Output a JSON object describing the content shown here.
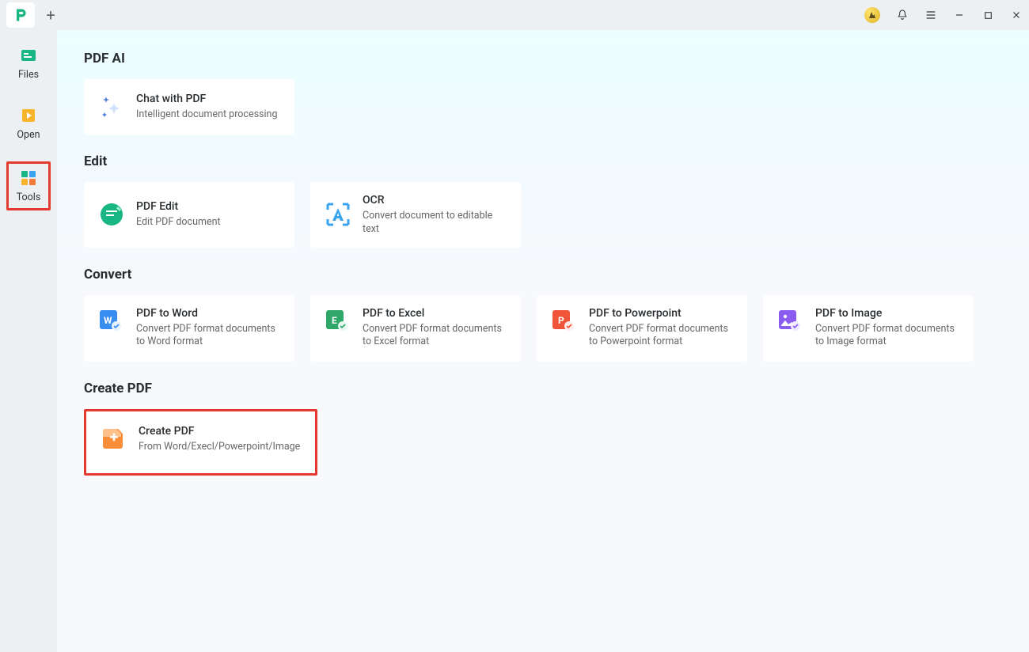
{
  "titlebar": {
    "new_tab_plus": "+"
  },
  "sidebar": {
    "items": [
      {
        "label": "Files"
      },
      {
        "label": "Open"
      },
      {
        "label": "Tools"
      }
    ]
  },
  "sections": {
    "pdf_ai": {
      "heading": "PDF AI",
      "cards": [
        {
          "title": "Chat with PDF",
          "sub": "Intelligent document processing"
        }
      ]
    },
    "edit": {
      "heading": "Edit",
      "cards": [
        {
          "title": "PDF Edit",
          "sub": "Edit PDF document"
        },
        {
          "title": "OCR",
          "sub": "Convert document to editable text"
        }
      ]
    },
    "convert": {
      "heading": "Convert",
      "cards": [
        {
          "title": "PDF to Word",
          "sub": "Convert PDF format documents to Word format"
        },
        {
          "title": "PDF to Excel",
          "sub": "Convert PDF format documents to Excel format"
        },
        {
          "title": "PDF to Powerpoint",
          "sub": "Convert PDF format documents to Powerpoint format"
        },
        {
          "title": "PDF to Image",
          "sub": "Convert PDF format documents to Image format"
        }
      ]
    },
    "create": {
      "heading": "Create PDF",
      "cards": [
        {
          "title": "Create PDF",
          "sub": "From Word/Execl/Powerpoint/Image"
        }
      ]
    }
  }
}
